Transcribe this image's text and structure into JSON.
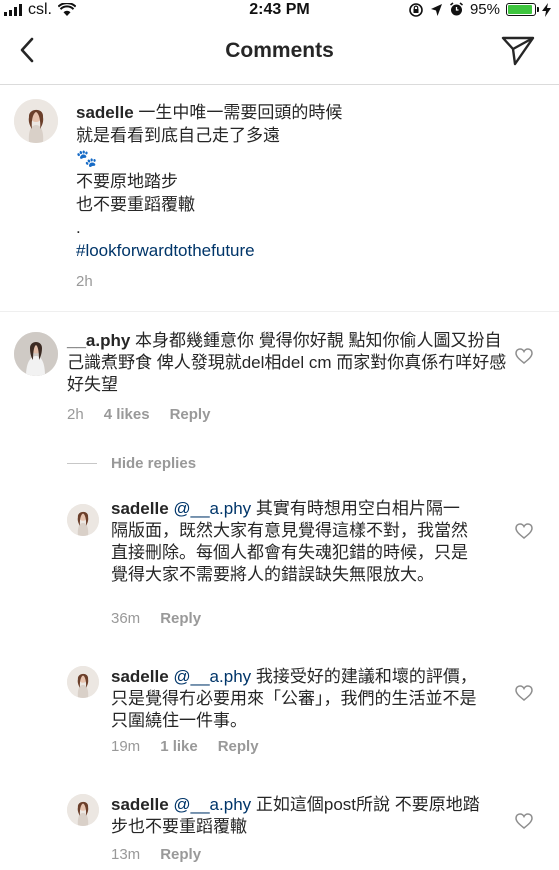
{
  "status_bar": {
    "carrier": "csl.",
    "time": "2:43 PM",
    "battery": "95%"
  },
  "header": {
    "title": "Comments"
  },
  "caption": {
    "username": "sadelle",
    "lines": [
      "一生中唯一需要回頭的時候",
      "就是看看到底自己走了多遠",
      "🐾",
      "不要原地踏步",
      "也不要重蹈覆轍",
      ".",
      "#lookforwardtothefuture"
    ],
    "time": "2h"
  },
  "comments": [
    {
      "username": "__a.phy",
      "text": "本身都幾鍾意你 覺得你好靚 點知你偷人圖又扮自己識煮野食 俾人發現就del相del cm 而家對你真係冇咩好感 好失望",
      "time": "2h",
      "likes": "4 likes",
      "reply": "Reply"
    }
  ],
  "hide_replies": "Hide replies",
  "replies": [
    {
      "username": "sadelle",
      "mention": "@__a.phy",
      "text": "其實有時想用空白相片隔一隔版面，既然大家有意見覺得這樣不對，我當然直接刪除。每個人都會有失魂犯錯的時候，只是覺得大家不需要將人的錯誤缺失無限放大。",
      "time": "36m",
      "likes": "",
      "reply": "Reply"
    },
    {
      "username": "sadelle",
      "mention": "@__a.phy",
      "text": "我接受好的建議和壞的評價，只是覺得冇必要用來「公審」，我們的生活並不是只圍繞住一件事。",
      "time": "19m",
      "likes": "1 like",
      "reply": "Reply"
    },
    {
      "username": "sadelle",
      "mention": "@__a.phy",
      "text": "正如這個post所說 不要原地踏步也不要重蹈覆轍",
      "time": "13m",
      "likes": "",
      "reply": "Reply"
    }
  ]
}
